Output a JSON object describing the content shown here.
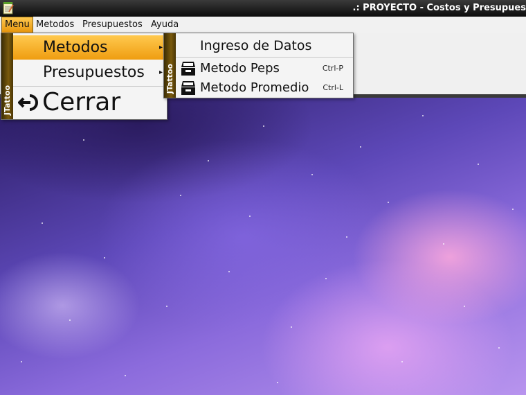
{
  "window": {
    "title": ".: PROYECTO - Costos y Presupues",
    "app_icon": "notepad-icon"
  },
  "menubar": {
    "items": [
      {
        "label": "Menu"
      },
      {
        "label": "Metodos"
      },
      {
        "label": "Presupuestos"
      },
      {
        "label": "Ayuda"
      }
    ]
  },
  "menu_popup": {
    "brand": "JTattoo",
    "items": [
      {
        "label": "Metodos",
        "submenu_arrow": "▸"
      },
      {
        "label": "Presupuestos",
        "submenu_arrow": "▸"
      },
      {
        "label": "Cerrar",
        "icon": "logout-icon"
      }
    ]
  },
  "metodos_popup": {
    "brand": "JTattoo",
    "header": "Ingreso de Datos",
    "items": [
      {
        "label": "Metodo Peps",
        "accelerator": "Ctrl-P",
        "icon": "cabinet-icon"
      },
      {
        "label": "Metodo Promedio",
        "accelerator": "Ctrl-L",
        "icon": "cabinet-icon"
      }
    ]
  },
  "colors": {
    "highlight": "#f0a320",
    "brand_strip": "#6b4e0a",
    "titlebar": "#1a1a1a"
  }
}
